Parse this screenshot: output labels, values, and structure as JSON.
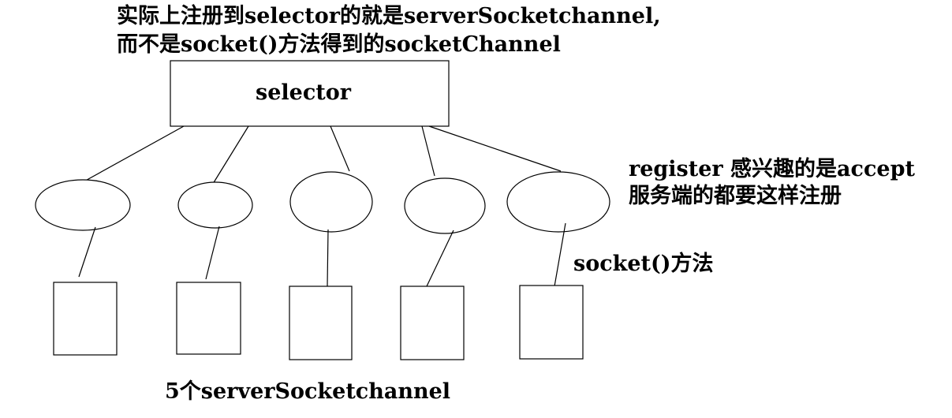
{
  "title": {
    "line1": "实际上注册到selector的就是serverSocketchannel,",
    "line2": "而不是socket()方法得到的socketChannel"
  },
  "selector_box": {
    "label": "selector"
  },
  "register_note": {
    "line1": "register 感兴趣的是accept",
    "line2": "服务端的都要这样注册"
  },
  "socket_method_label": "socket()方法",
  "bottom_caption": "5个serverSocketchannel",
  "channel_count": 5,
  "colors": {
    "stroke": "#000000",
    "background": "#ffffff",
    "text": "#000000"
  }
}
